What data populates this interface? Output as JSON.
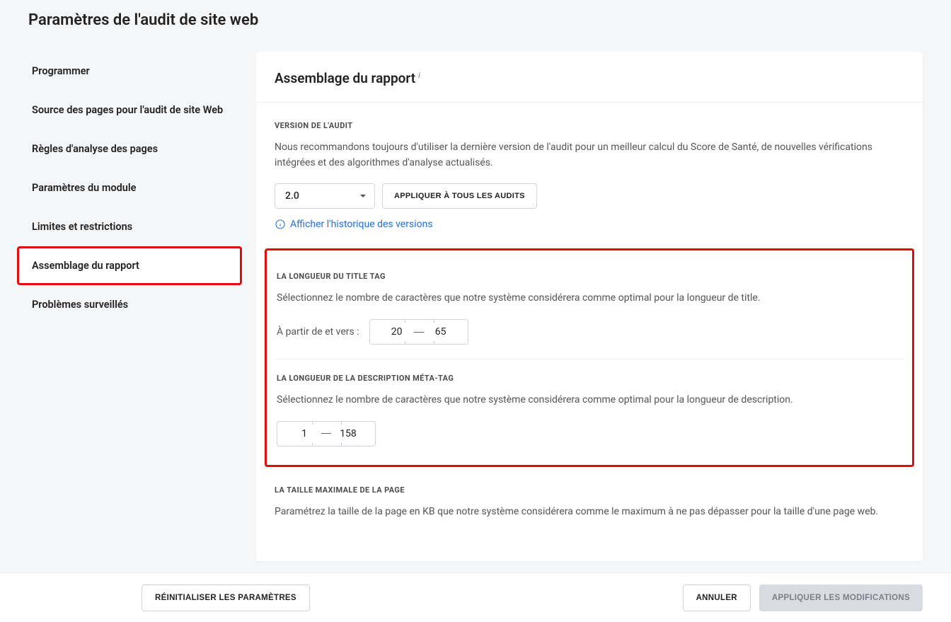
{
  "page_title": "Paramètres de l'audit de site web",
  "sidebar": {
    "items": [
      {
        "label": "Programmer"
      },
      {
        "label": "Source des pages pour l'audit de site Web"
      },
      {
        "label": "Règles d'analyse des pages"
      },
      {
        "label": "Paramètres du module"
      },
      {
        "label": "Limites et restrictions"
      },
      {
        "label": "Assemblage du rapport"
      },
      {
        "label": "Problèmes surveillés"
      }
    ]
  },
  "panel": {
    "heading": "Assemblage du rapport"
  },
  "audit_version": {
    "label": "VERSION DE L'AUDIT",
    "description": "Nous recommandons toujours d'utiliser la dernière version de l'audit pour un meilleur calcul du Score de Santé, de nouvelles vérifications intégrées et des algorithmes d'analyse actualisés.",
    "selected": "2.0",
    "apply_all_label": "APPLIQUER À TOUS LES AUDITS",
    "history_link": "Afficher l'historique des versions"
  },
  "title_tag": {
    "label": "LA LONGUEUR DU TITLE TAG",
    "description": "Sélectionnez le nombre de caractères que notre système considérera comme optimal pour la longueur de title.",
    "range_label": "À partir de et vers :",
    "from": "20",
    "to": "65"
  },
  "meta_desc": {
    "label": "LA LONGUEUR DE LA DESCRIPTION MÉTA-TAG",
    "description": "Sélectionnez le nombre de caractères que notre système considérera comme optimal pour la longueur de description.",
    "from": "1",
    "to": "158"
  },
  "page_size": {
    "label": "LA TAILLE MAXIMALE DE LA PAGE",
    "description": "Paramétrez la taille de la page en KB que notre système considérera comme le maximum à ne pas dépasser pour la taille d'une page web."
  },
  "footer": {
    "reset_label": "RÉINITIALISER LES PARAMÈTRES",
    "cancel_label": "ANNULER",
    "apply_label": "APPLIQUER LES MODIFICATIONS"
  }
}
